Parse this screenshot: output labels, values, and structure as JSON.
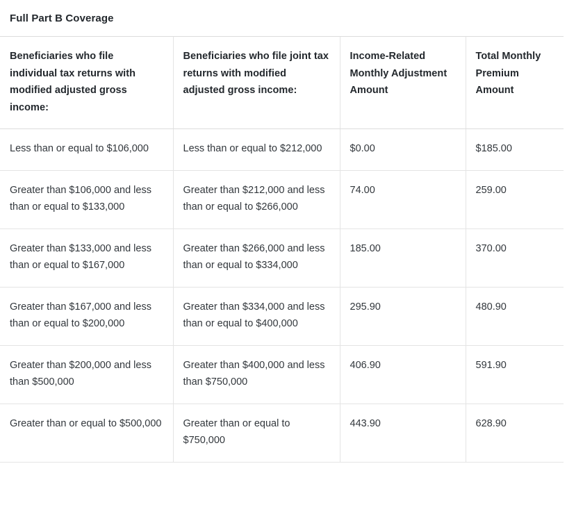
{
  "table": {
    "title": "Full Part B Coverage",
    "columns": [
      "Beneficiaries who file individual tax returns with modified adjusted gross income:",
      "Beneficiaries who file joint tax returns with modified adjusted gross income:",
      "Income-Related Monthly Adjustment Amount",
      "Total Monthly Premium Amount"
    ],
    "rows": [
      {
        "individual_income": "Less than or equal to $106,000",
        "joint_income": "Less than or equal to $212,000",
        "irmaa": "$0.00",
        "total_premium": "$185.00"
      },
      {
        "individual_income": "Greater than $106,000 and less than or equal to $133,000",
        "joint_income": "Greater than $212,000 and less than or equal to $266,000",
        "irmaa": "74.00",
        "total_premium": "259.00"
      },
      {
        "individual_income": "Greater than $133,000 and less than or equal to $167,000",
        "joint_income": "Greater than $266,000 and less than or equal to $334,000",
        "irmaa": "185.00",
        "total_premium": "370.00"
      },
      {
        "individual_income": "Greater than $167,000 and less than or equal to $200,000",
        "joint_income": "Greater than $334,000 and less than or equal to $400,000",
        "irmaa": "295.90",
        "total_premium": "480.90"
      },
      {
        "individual_income": "Greater than $200,000 and less than $500,000",
        "joint_income": "Greater than $400,000 and less than $750,000",
        "irmaa": "406.90",
        "total_premium": "591.90"
      },
      {
        "individual_income": "Greater than or equal to $500,000",
        "joint_income": "Greater than or equal to $750,000",
        "irmaa": "443.90",
        "total_premium": "628.90"
      }
    ]
  },
  "colors": {
    "text": "#32373c",
    "heading": "#23282d",
    "border": "#e4e4e4",
    "background": "#ffffff"
  }
}
